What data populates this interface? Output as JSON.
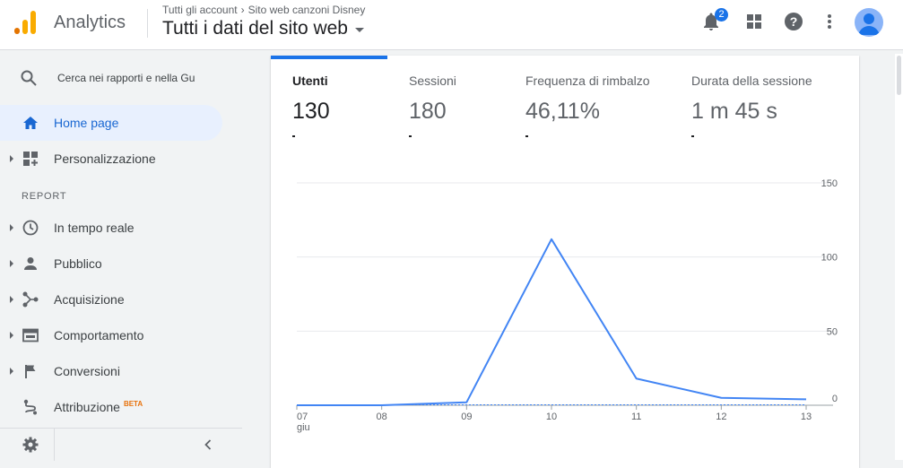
{
  "header": {
    "app_name": "Analytics",
    "breadcrumb_account": "Tutti gli account",
    "breadcrumb_property": "Sito web canzoni Disney",
    "view_title": "Tutti i dati del sito web",
    "notifications_count": "2"
  },
  "sidebar": {
    "search_placeholder": "Cerca nei rapporti e nella Gu",
    "home": "Home page",
    "customization": "Personalizzazione",
    "reports_header": "REPORT",
    "items": [
      {
        "label": "In tempo reale",
        "icon": "clock-icon"
      },
      {
        "label": "Pubblico",
        "icon": "person-icon"
      },
      {
        "label": "Acquisizione",
        "icon": "acquisition-icon"
      },
      {
        "label": "Comportamento",
        "icon": "behavior-icon"
      },
      {
        "label": "Conversioni",
        "icon": "flag-icon"
      },
      {
        "label": "Attribuzione",
        "icon": "attribution-icon",
        "badge": "BETA"
      }
    ]
  },
  "metrics": [
    {
      "label": "Utenti",
      "value": "130",
      "active": true
    },
    {
      "label": "Sessioni",
      "value": "180",
      "active": false
    },
    {
      "label": "Frequenza di rimbalzo",
      "value": "46,11%",
      "active": false
    },
    {
      "label": "Durata della sessione",
      "value": "1 m 45 s",
      "active": false
    }
  ],
  "colors": {
    "accent": "#1a73e8",
    "line": "#4285f4",
    "logo_orange": "#f9ab00",
    "logo_dark": "#e37400"
  },
  "chart_data": {
    "type": "line",
    "x": [
      "07",
      "08",
      "09",
      "10",
      "11",
      "12",
      "13"
    ],
    "x_sublabel": "giu",
    "values": [
      0,
      0,
      2,
      112,
      18,
      5,
      4
    ],
    "ylim": [
      0,
      150
    ],
    "yticks": [
      "0",
      "50",
      "100",
      "150"
    ],
    "grid": true
  }
}
